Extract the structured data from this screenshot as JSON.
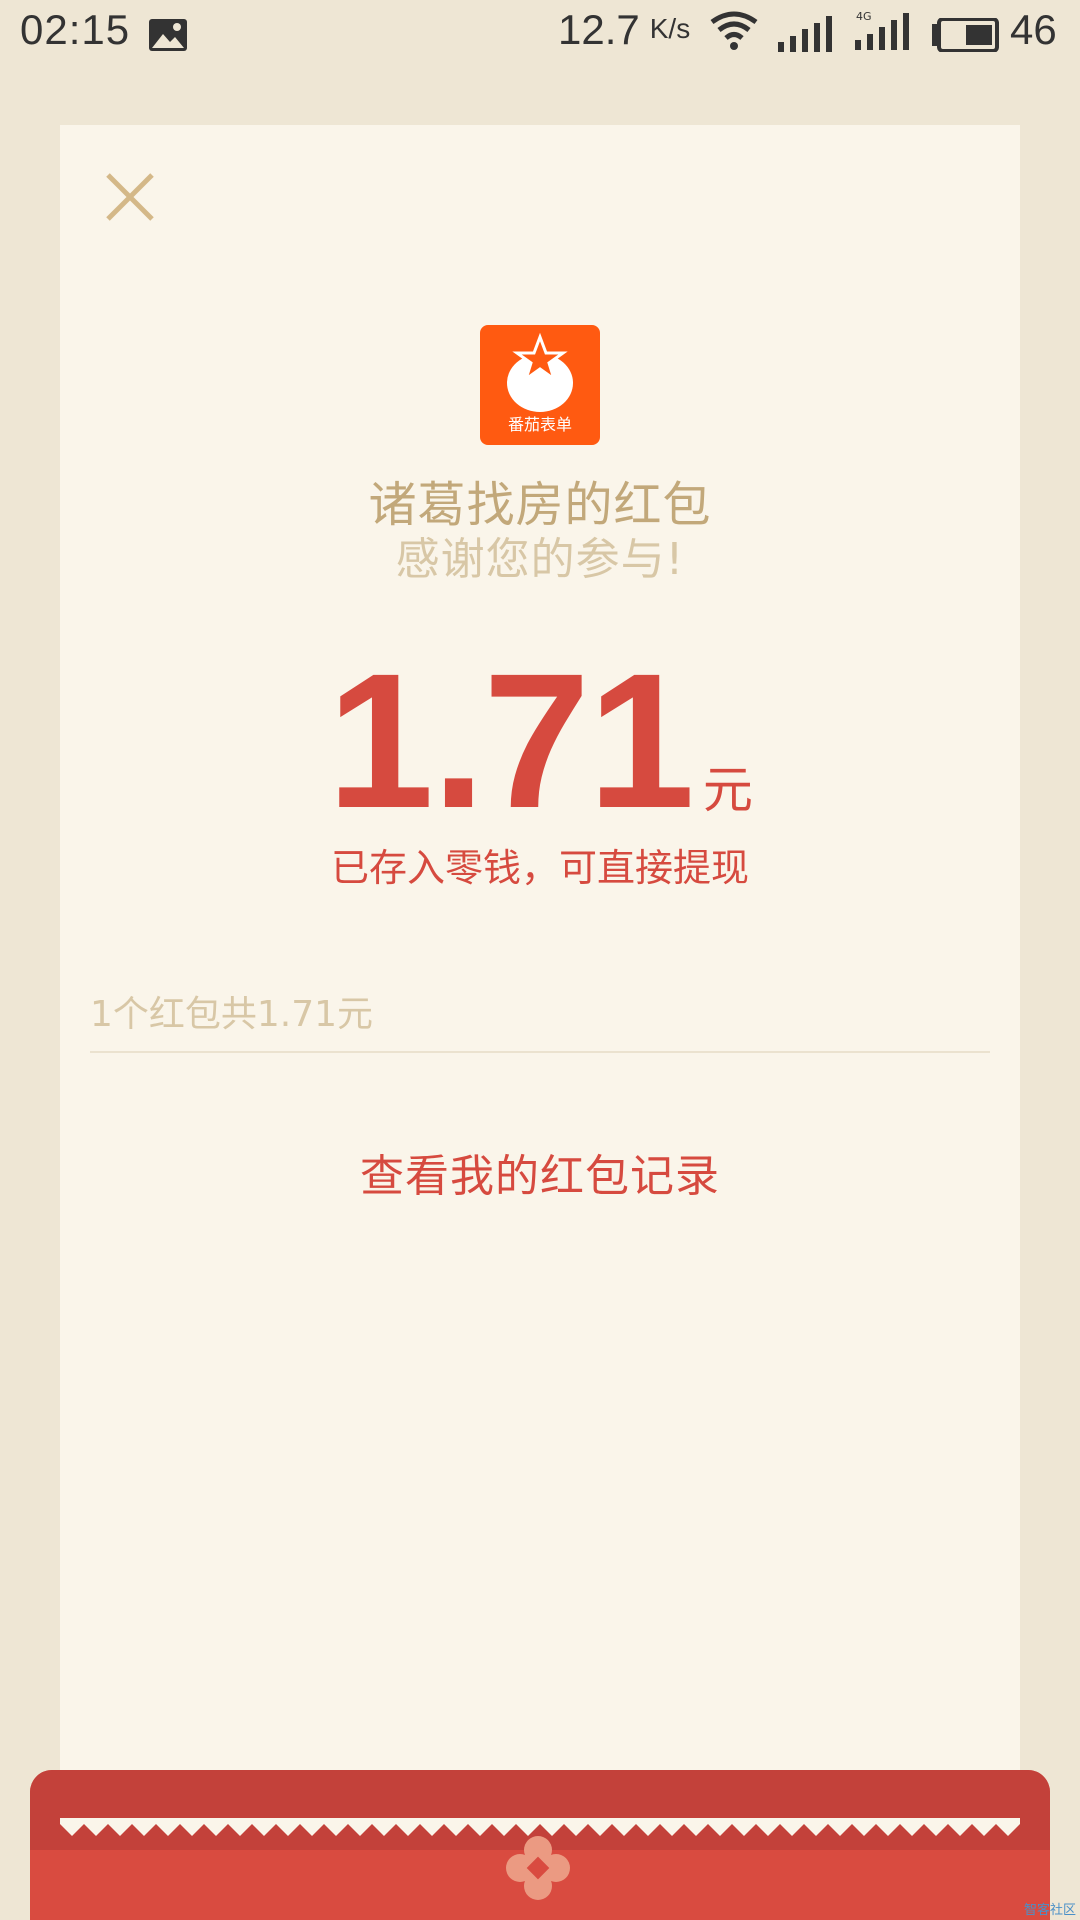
{
  "status_bar": {
    "time": "02:15",
    "gallery_icon": "image-notification-icon",
    "net_speed": "12.7",
    "net_speed_unit": "K/s",
    "wifi_icon": "wifi-icon",
    "signal_icon": "cell-signal-icon",
    "network_type": "4G",
    "battery_icon": "battery-icon",
    "battery_level": "46"
  },
  "card": {
    "close_icon": "close-icon",
    "app_logo_icon": "tomato-app-logo",
    "app_logo_text": "番茄表单",
    "sender_title": "诸葛找房的红包",
    "thanks_text": "感谢您的参与!",
    "amount": "1.71",
    "amount_unit": "元",
    "notice": "已存入零钱，可直接提现",
    "summary": "1个红包共1.71元",
    "records_link": "查看我的红包记录"
  },
  "envelope": {
    "flower_icon": "flower-emblem-icon"
  },
  "watermark": "智客社区",
  "colors": {
    "background": "#eee6d4",
    "card": "#faf5ea",
    "accent_red": "#d64a3f",
    "gold_text": "#c2a87a",
    "light_gold": "#d8c7a6",
    "envelope_red": "#d94b40",
    "logo_orange": "#ff5a11"
  }
}
